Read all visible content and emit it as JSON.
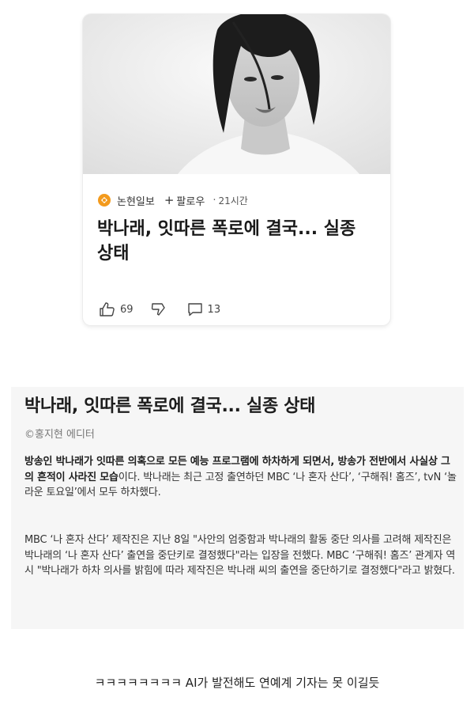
{
  "card": {
    "publisher": "논현일보",
    "follow_label": "팔로우",
    "time": "21시간",
    "title": "박나래, 잇따른 폭로에 결국... 실종 상태",
    "likes": "69",
    "comments": "13",
    "brand_color": "#f39a1d"
  },
  "article": {
    "title": "박나래, 잇따른 폭로에 결국... 실종 상태",
    "byline": "©홍지현 에디터",
    "para1_bold": "방송인 박나래가 잇따른 의혹으로 모든 예능 프로그램에 하차하게 되면서, 방송가 전반에서 사실상 그의 흔적이 사라진 모습",
    "para1_rest": "이다. 박나래는 최근 고정 출연하던 MBC ‘나 혼자 산다’, ‘구해줘! 홈즈’, tvN ‘놀라운 토요일’에서 모두 하차했다.",
    "para2": "MBC ‘나 혼자 산다’ 제작진은 지난 8일 \"사안의 엄중함과 박나래의 활동 중단 의사를 고려해 제작진은 박나래의 ‘나 혼자 산다’ 출연을 중단키로 결정했다\"라는 입장을 전했다. MBC ‘구해줘! 홈즈’ 관계자 역시 \"박나래가 하차 의사를 밝힘에 따라 제작진은 박나래 씨의 출연을 중단하기로 결정했다\"라고 밝혔다."
  },
  "caption": "ㅋㅋㅋㅋㅋㅋㅋㅋ AI가 발전해도 연예계 기자는 못 이길듯"
}
